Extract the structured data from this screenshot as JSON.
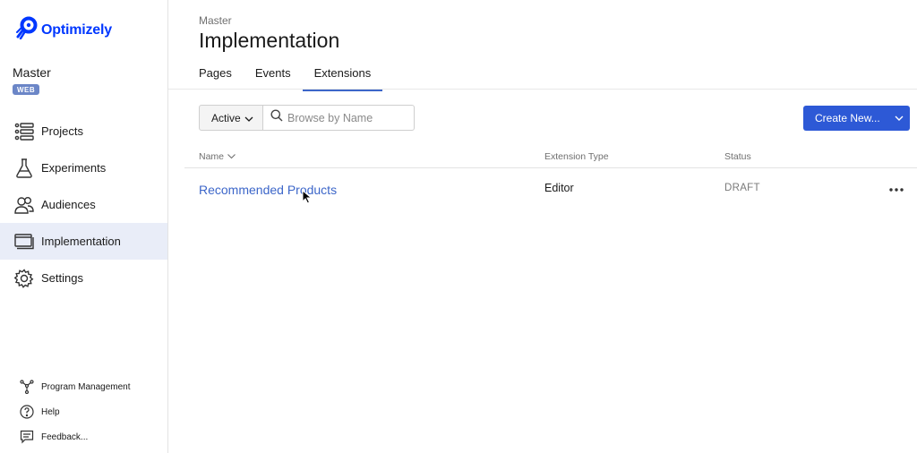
{
  "brand": {
    "name": "Optimizely",
    "color": "#0037ff"
  },
  "sidebar": {
    "project_name": "Master",
    "platform_badge": "WEB",
    "items": [
      {
        "label": "Projects",
        "icon": "projects-icon",
        "active": false
      },
      {
        "label": "Experiments",
        "icon": "flask-icon",
        "active": false
      },
      {
        "label": "Audiences",
        "icon": "audiences-icon",
        "active": false
      },
      {
        "label": "Implementation",
        "icon": "implementation-icon",
        "active": true
      },
      {
        "label": "Settings",
        "icon": "gear-icon",
        "active": false
      }
    ],
    "footer": [
      {
        "label": "Program Management",
        "icon": "program-management-icon"
      },
      {
        "label": "Help",
        "icon": "help-icon"
      },
      {
        "label": "Feedback...",
        "icon": "feedback-icon"
      }
    ]
  },
  "header": {
    "breadcrumb": "Master",
    "title": "Implementation"
  },
  "tabs": [
    {
      "label": "Pages",
      "active": false
    },
    {
      "label": "Events",
      "active": false
    },
    {
      "label": "Extensions",
      "active": true
    }
  ],
  "filter": {
    "selected": "Active",
    "search_placeholder": "Browse by Name",
    "search_value": ""
  },
  "create_button": {
    "label": "Create New..."
  },
  "table": {
    "columns": [
      "Name",
      "Extension Type",
      "Status"
    ],
    "rows": [
      {
        "name": "Recommended Products",
        "type": "Editor",
        "status": "DRAFT"
      }
    ]
  },
  "colors": {
    "accent": "#2d59d6",
    "link": "#3c66c9",
    "active_nav_bg": "#e9edf8",
    "badge": "#6b86c7"
  }
}
